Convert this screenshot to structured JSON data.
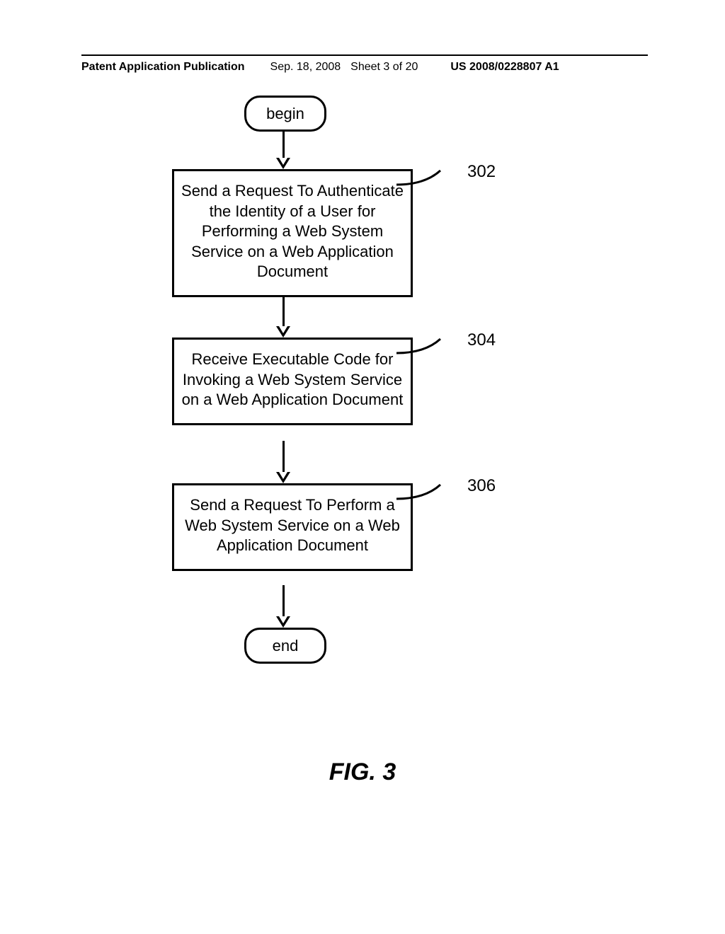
{
  "header": {
    "publication": "Patent Application Publication",
    "date": "Sep. 18, 2008",
    "sheet": "Sheet 3 of 20",
    "number": "US 2008/0228807 A1"
  },
  "flow": {
    "begin": "begin",
    "step302": "Send a Request To Authenticate the Identity of a User for Performing a Web System Service on a Web Application Document",
    "step304": "Receive Executable Code for Invoking a Web System Service on a Web Application Document",
    "step306": "Send a Request To Perform a Web System Service on a Web Application Document",
    "end": "end",
    "ref302": "302",
    "ref304": "304",
    "ref306": "306"
  },
  "caption": "FIG. 3"
}
